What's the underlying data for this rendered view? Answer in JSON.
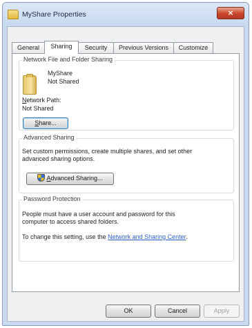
{
  "window": {
    "title": "MyShare Properties",
    "close_glyph": "×"
  },
  "tabs": [
    {
      "label": "General",
      "active": false
    },
    {
      "label": "Sharing",
      "active": true
    },
    {
      "label": "Security",
      "active": false
    },
    {
      "label": "Previous Versions",
      "active": false
    },
    {
      "label": "Customize",
      "active": false
    }
  ],
  "network_sharing": {
    "group_title": "Network File and Folder Sharing",
    "folder_name": "MyShare",
    "folder_status": "Not Shared",
    "path_label_accel": "N",
    "path_label_rest": "etwork Path:",
    "path_value": "Not Shared",
    "share_button_accel": "S",
    "share_button_rest": "hare..."
  },
  "advanced_sharing": {
    "group_title": "Advanced Sharing",
    "description_line1": "Set custom permissions, create multiple shares, and set other",
    "description_line2": "advanced sharing options.",
    "button_accel": "A",
    "button_rest": "dvanced Sharing..."
  },
  "password_protection": {
    "group_title": "Password Protection",
    "description_line1": "People must have a user account and password for this",
    "description_line2": "computer to access shared folders.",
    "change_text": "To change this setting, use the ",
    "link_text": "Network and Sharing Center",
    "change_suffix": "."
  },
  "footer": {
    "ok_label": "OK",
    "cancel_label": "Cancel",
    "apply_label": "Apply"
  },
  "colors": {
    "link": "#2a5fc4",
    "close_button": "#c9452b",
    "title_bar": "#c6d8ef"
  },
  "icons": {
    "title": "folder-icon",
    "shared_folder": "folder-icon",
    "advanced_button": "uac-shield-icon"
  }
}
